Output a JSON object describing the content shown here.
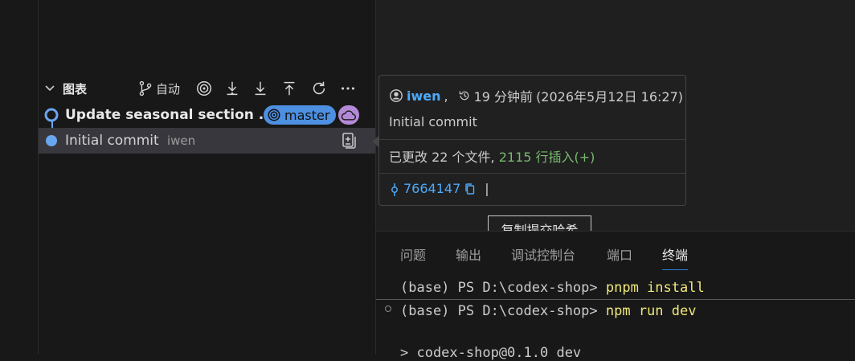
{
  "graph": {
    "title": "图表",
    "auto_label": "自动",
    "commits": [
      {
        "message": "Update seasonal section ...",
        "branch": "master"
      },
      {
        "message": "Initial commit",
        "author": "iwen"
      }
    ]
  },
  "hover": {
    "author": "iwen",
    "sep": ",",
    "relative_time": "19 分钟前",
    "absolute_time": "(2026年5月12日 16:27)",
    "message": "Initial commit",
    "changes_prefix": "已更改 22 个文件,",
    "insertions": "2115 行插入(+)",
    "hash": "7664147",
    "cursor": "|"
  },
  "tooltip": {
    "text": "复制提交哈希"
  },
  "panel": {
    "tabs": [
      "问题",
      "输出",
      "调试控制台",
      "端口",
      "终端"
    ],
    "terminal": [
      {
        "prompt": "(base) PS D:\\codex-shop> ",
        "command": "pnpm install"
      },
      {
        "prompt": "(base) PS D:\\codex-shop> ",
        "command": "npm run dev"
      },
      {
        "prompt": "> codex-shop@0.1.0 dev",
        "command": ""
      }
    ]
  },
  "colors": {
    "accent": "#4d8fe0",
    "cloud": "#b48ad8",
    "link": "#4daafc",
    "insert": "#79b86f",
    "cmd": "#f0e87a"
  }
}
